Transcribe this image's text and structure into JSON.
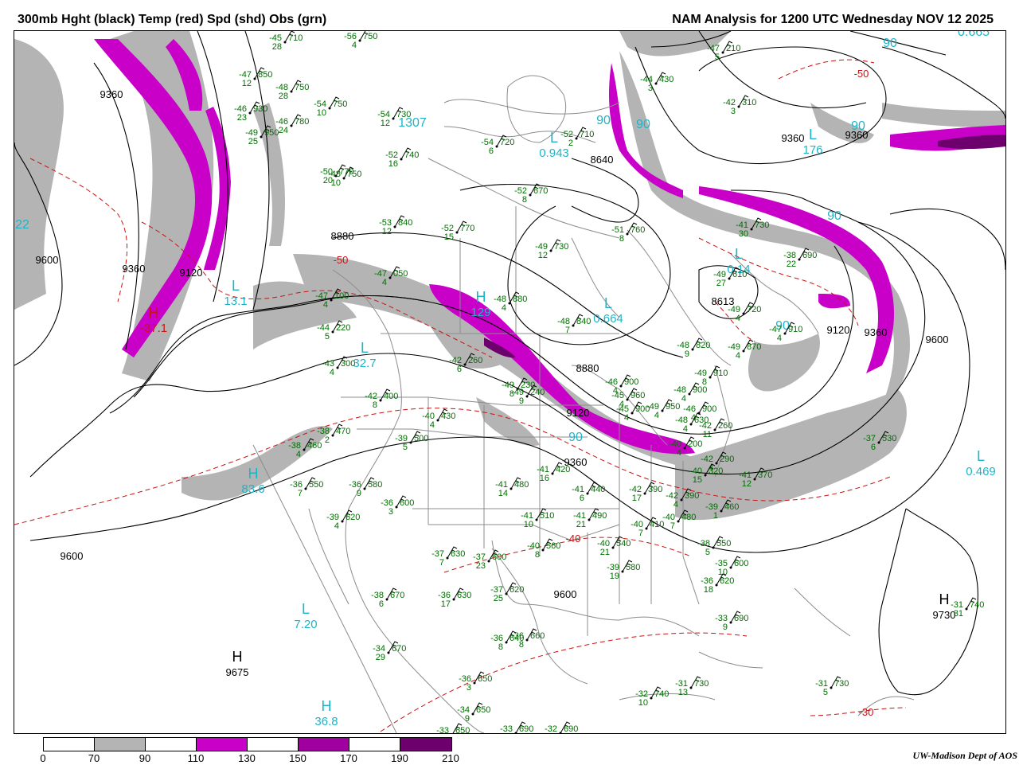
{
  "header": {
    "left_title": "300mb Hght (black) Temp (red) Spd (shd) Obs (grn)",
    "right_title": "NAM Analysis for 1200 UTC Wednesday  NOV 12 2025"
  },
  "legend": {
    "labels": [
      "0",
      "70",
      "90",
      "110",
      "130",
      "150",
      "170",
      "190",
      "210"
    ],
    "colors": [
      "#ffffff",
      "#b4b4b4",
      "#ffffff",
      "#c800c8",
      "#ffffff",
      "#a000a0",
      "#ffffff",
      "#6e006e"
    ]
  },
  "credit": "UW-Madison  Dept of AOS",
  "colors": {
    "height_contour": "#000000",
    "temp_contour": "#c81414",
    "speed_70_90": "#b4b4b4",
    "speed_110_130": "#c800c8",
    "speed_150_170": "#a000a0",
    "obs": "#006e00",
    "speed_labels": "#1eb4c8",
    "boundaries": "#8c8c8c"
  },
  "height_labels": [
    "9360",
    "9600",
    "9360",
    "9120",
    "8880",
    "8640",
    "9360",
    "9120",
    "9360",
    "9600",
    "8880",
    "9120",
    "9360",
    "9600",
    "9600",
    "8613",
    "9360"
  ],
  "pressure_centers": [
    {
      "type": "H",
      "value": "9675"
    },
    {
      "type": "H",
      "value": "9730"
    },
    {
      "type": "L",
      "value": "7.20"
    },
    {
      "type": "H",
      "value": "83.6"
    },
    {
      "type": "L",
      "value": "32.7"
    },
    {
      "type": "L",
      "value": "13.1"
    },
    {
      "type": "H",
      "value": "129"
    },
    {
      "type": "L",
      "value": "0.664"
    },
    {
      "type": "L",
      "value": "0.943"
    },
    {
      "type": "L",
      "value": "176"
    },
    {
      "type": "L",
      "value": "0.469"
    },
    {
      "type": "H",
      "value": "36.8"
    },
    {
      "type": "H",
      "value": "-37.1"
    },
    {
      "type": "L",
      "value": "0.14"
    }
  ],
  "speed_labels": [
    "90",
    "90",
    "90",
    "90",
    "90",
    "22",
    "0.665",
    "1307",
    "90",
    "90"
  ],
  "temp_labels": [
    "-50",
    "-50",
    "-40",
    "-30",
    "-50"
  ],
  "observations": [
    {
      "t": "-45",
      "h": "710",
      "d": "28"
    },
    {
      "t": "-56",
      "h": "750",
      "d": "4"
    },
    {
      "t": "-47",
      "h": "850",
      "d": "12"
    },
    {
      "t": "-48",
      "h": "750",
      "d": "28"
    },
    {
      "t": "-54",
      "h": "750",
      "d": "10"
    },
    {
      "t": "-46",
      "h": "930",
      "d": "23"
    },
    {
      "t": "-46",
      "h": "780",
      "d": "24"
    },
    {
      "t": "-49",
      "h": "950",
      "d": "25"
    },
    {
      "t": "-54",
      "h": "730",
      "d": "12"
    },
    {
      "t": "-54",
      "h": "720",
      "d": "6"
    },
    {
      "t": "-52",
      "h": "710",
      "d": "2"
    },
    {
      "t": "-44",
      "h": "430",
      "d": "3"
    },
    {
      "t": "-47",
      "h": "210",
      "d": "5"
    },
    {
      "t": "-42",
      "h": "310",
      "d": "3"
    },
    {
      "t": "-52",
      "h": "740",
      "d": "16"
    },
    {
      "t": "-50",
      "h": "770",
      "d": "20"
    },
    {
      "t": "-48",
      "h": "750",
      "d": "10"
    },
    {
      "t": "-52",
      "h": "670",
      "d": "8"
    },
    {
      "t": "-53",
      "h": "840",
      "d": "12"
    },
    {
      "t": "-52",
      "h": "770",
      "d": "15"
    },
    {
      "t": "-51",
      "h": "760",
      "d": "8"
    },
    {
      "t": "-49",
      "h": "730",
      "d": "12"
    },
    {
      "t": "-47",
      "h": "100",
      "d": "4"
    },
    {
      "t": "-47",
      "h": "050",
      "d": "4"
    },
    {
      "t": "-44",
      "h": "220",
      "d": "5"
    },
    {
      "t": "-48",
      "h": "880",
      "d": "4"
    },
    {
      "t": "-48",
      "h": "840",
      "d": "7"
    },
    {
      "t": "-48",
      "h": "820",
      "d": "9"
    },
    {
      "t": "-43",
      "h": "300",
      "d": "4"
    },
    {
      "t": "-42",
      "h": "260",
      "d": "6"
    },
    {
      "t": "-42",
      "h": "400",
      "d": "8"
    },
    {
      "t": "-40",
      "h": "430",
      "d": "4"
    },
    {
      "t": "-49",
      "h": "230",
      "d": "8"
    },
    {
      "t": "-49",
      "h": "240",
      "d": "9"
    },
    {
      "t": "-38",
      "h": "470",
      "d": "2"
    },
    {
      "t": "-38",
      "h": "460",
      "d": "4"
    },
    {
      "t": "-39",
      "h": "500",
      "d": "5"
    },
    {
      "t": "-36",
      "h": "550",
      "d": "7"
    },
    {
      "t": "-36",
      "h": "580",
      "d": "9"
    },
    {
      "t": "-36",
      "h": "600",
      "d": "3"
    },
    {
      "t": "-39",
      "h": "620",
      "d": "4"
    },
    {
      "t": "-41",
      "h": "480",
      "d": "14"
    },
    {
      "t": "-41",
      "h": "420",
      "d": "16"
    },
    {
      "t": "-41",
      "h": "440",
      "d": "6"
    },
    {
      "t": "-41",
      "h": "510",
      "d": "10"
    },
    {
      "t": "-41",
      "h": "490",
      "d": "21"
    },
    {
      "t": "-42",
      "h": "390",
      "d": "17"
    },
    {
      "t": "-37",
      "h": "630",
      "d": "7"
    },
    {
      "t": "-37",
      "h": "600",
      "d": "23"
    },
    {
      "t": "-40",
      "h": "560",
      "d": "8"
    },
    {
      "t": "-40",
      "h": "540",
      "d": "21"
    },
    {
      "t": "-40",
      "h": "410",
      "d": "7"
    },
    {
      "t": "-40",
      "h": "480",
      "d": "7"
    },
    {
      "t": "-39",
      "h": "580",
      "d": "19"
    },
    {
      "t": "-38",
      "h": "550",
      "d": "5"
    },
    {
      "t": "-35",
      "h": "600",
      "d": "10"
    },
    {
      "t": "-36",
      "h": "620",
      "d": "18"
    },
    {
      "t": "-38",
      "h": "670",
      "d": "6"
    },
    {
      "t": "-36",
      "h": "630",
      "d": "17"
    },
    {
      "t": "-37",
      "h": "620",
      "d": "25"
    },
    {
      "t": "-36",
      "h": "640",
      "d": "8"
    },
    {
      "t": "-36",
      "h": "660",
      "d": "8"
    },
    {
      "t": "-34",
      "h": "670",
      "d": "29"
    },
    {
      "t": "-33",
      "h": "690",
      "d": "9"
    },
    {
      "t": "-36",
      "h": "650",
      "d": "3"
    },
    {
      "t": "-34",
      "h": "650",
      "d": "9"
    },
    {
      "t": "-33",
      "h": "650",
      "d": ""
    },
    {
      "t": "-33",
      "h": "690",
      "d": ""
    },
    {
      "t": "-32",
      "h": "690",
      "d": ""
    },
    {
      "t": "-32",
      "h": "740",
      "d": "10"
    },
    {
      "t": "-31",
      "h": "730",
      "d": "13"
    },
    {
      "t": "-31",
      "h": "730",
      "d": "5"
    },
    {
      "t": "-31",
      "h": "740",
      "d": "31"
    },
    {
      "t": "-37",
      "h": "530",
      "d": "6"
    },
    {
      "t": "-41",
      "h": "370",
      "d": "12"
    },
    {
      "t": "-39",
      "h": "460",
      "d": "1"
    },
    {
      "t": "-46",
      "h": "900",
      "d": "4"
    },
    {
      "t": "-45",
      "h": "960",
      "d": "4"
    },
    {
      "t": "-49",
      "h": "910",
      "d": "8"
    },
    {
      "t": "-48",
      "h": "900",
      "d": "4"
    },
    {
      "t": "-49",
      "h": "950",
      "d": "4"
    },
    {
      "t": "-45",
      "h": "900",
      "d": "4"
    },
    {
      "t": "-46",
      "h": "900",
      "d": "4"
    },
    {
      "t": "-42",
      "h": "290",
      "d": "4"
    },
    {
      "t": "-40",
      "h": "320",
      "d": "15"
    },
    {
      "t": "-42",
      "h": "390",
      "d": "4"
    },
    {
      "t": "-40",
      "h": "200",
      "d": "4"
    },
    {
      "t": "-42",
      "h": "260",
      "d": "11"
    },
    {
      "t": "-48",
      "h": "630",
      "d": "4"
    },
    {
      "t": "-49",
      "h": "720",
      "d": "4"
    },
    {
      "t": "-47",
      "h": "910",
      "d": "4"
    },
    {
      "t": "-49",
      "h": "870",
      "d": "4"
    },
    {
      "t": "-49",
      "h": "610",
      "d": "27"
    },
    {
      "t": "-38",
      "h": "690",
      "d": "22"
    },
    {
      "t": "-41",
      "h": "730",
      "d": "30"
    }
  ]
}
